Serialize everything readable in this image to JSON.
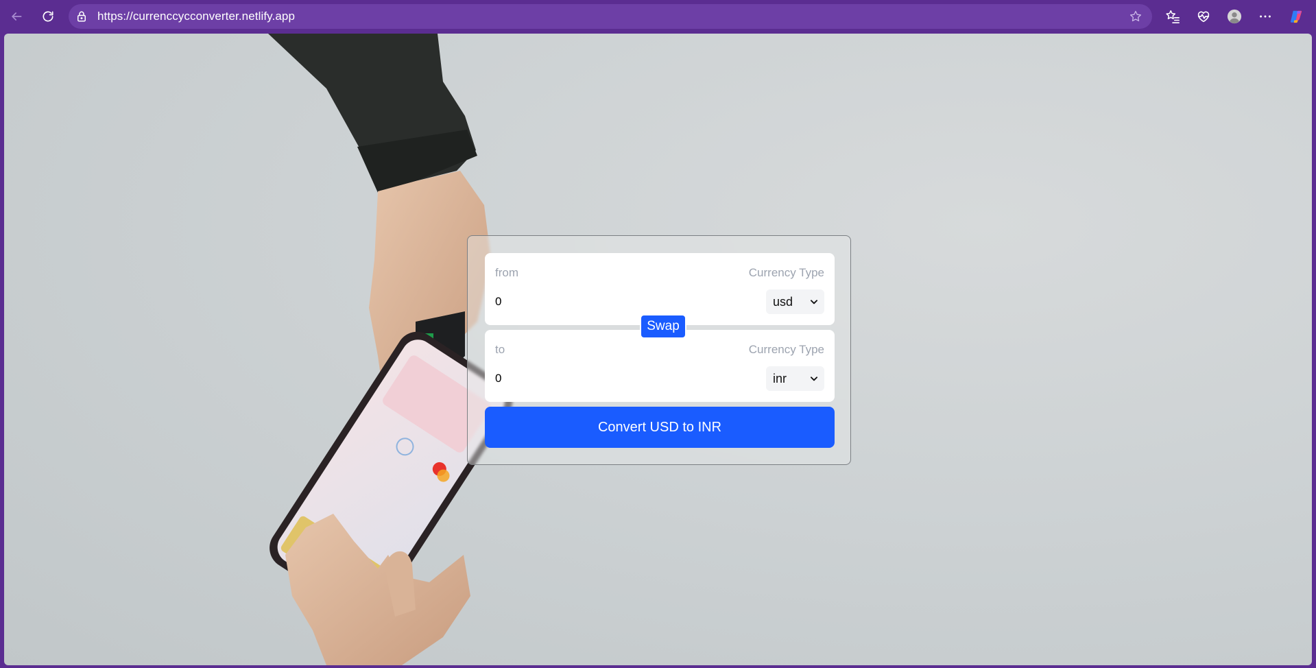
{
  "browser": {
    "url": "https://currenccycconverter.netlify.app"
  },
  "converter": {
    "from": {
      "label": "from",
      "currency_type_label": "Currency Type",
      "amount": "0",
      "currency": "usd"
    },
    "to": {
      "label": "to",
      "currency_type_label": "Currency Type",
      "amount": "0",
      "currency": "inr"
    },
    "swap_label": "Swap",
    "convert_label": "Convert USD to INR"
  },
  "colors": {
    "browser_frame": "#5b2d91",
    "accent_button": "#1a5cff",
    "card_border": "#7b7f83",
    "placeholder_text": "#9ca3af"
  },
  "icons": [
    "back-icon",
    "refresh-icon",
    "lock-icon",
    "favorite-star-icon",
    "favorites-list-icon",
    "browser-essentials-icon",
    "profile-icon",
    "more-icon",
    "copilot-icon",
    "chevron-down-icon"
  ]
}
